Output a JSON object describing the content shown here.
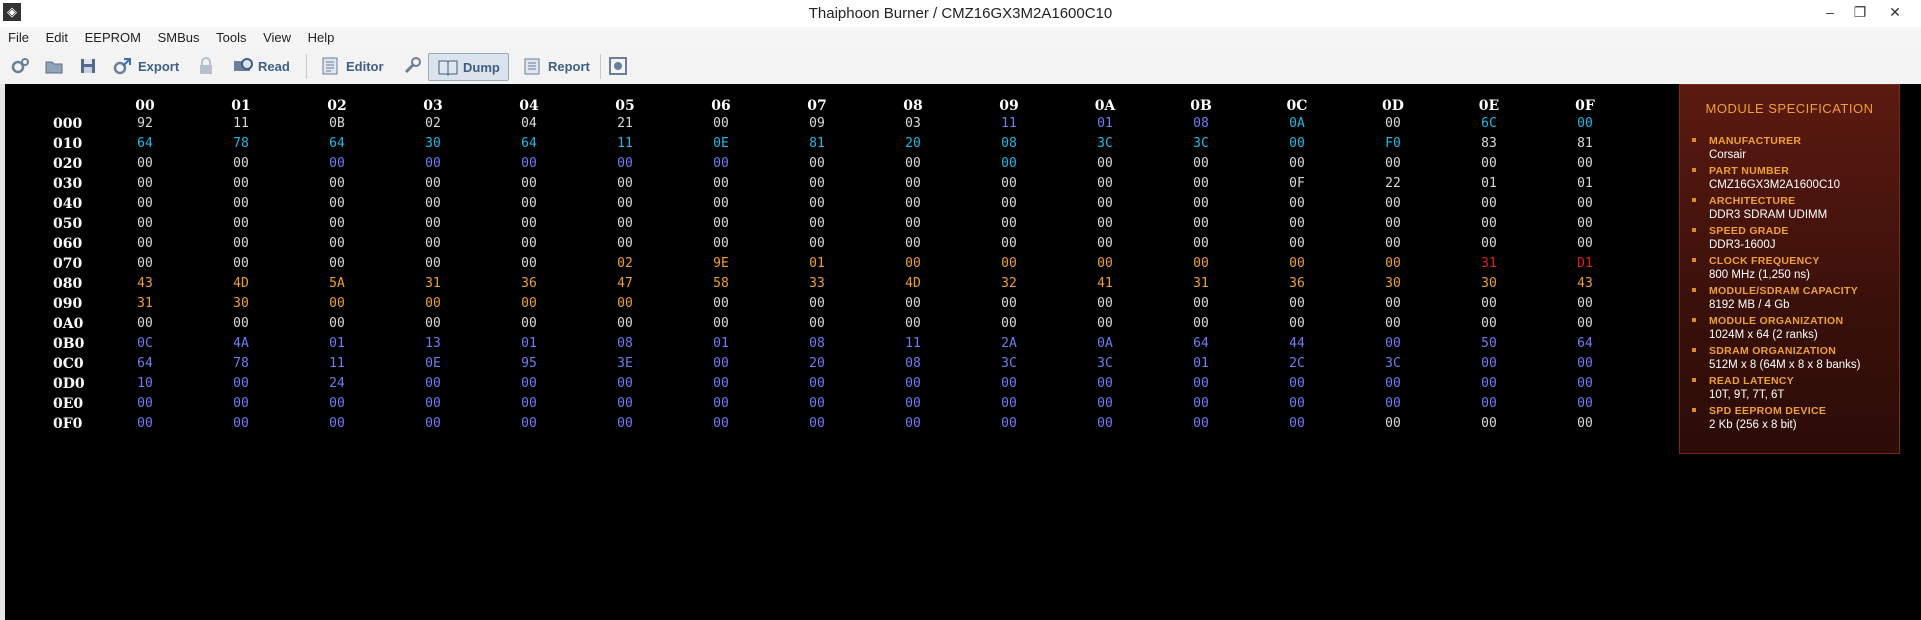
{
  "window": {
    "title": "Thaiphoon Burner / CMZ16GX3M2A1600C10",
    "minimize": "–",
    "restore": "❐",
    "close": "✕"
  },
  "menu": [
    "File",
    "Edit",
    "EEPROM",
    "SMBus",
    "Tools",
    "View",
    "Help"
  ],
  "toolbar": {
    "export": "Export",
    "read": "Read",
    "editor": "Editor",
    "dump": "Dump",
    "report": "Report"
  },
  "colors": {
    "white": "#d9d9d9",
    "cyan": "#21b8e8",
    "blue": "#6f7cf0",
    "orange": "#f0a030",
    "red": "#e02020"
  },
  "dump": {
    "columns": [
      "00",
      "01",
      "02",
      "03",
      "04",
      "05",
      "06",
      "07",
      "08",
      "09",
      "0A",
      "0B",
      "0C",
      "0D",
      "0E",
      "0F"
    ],
    "rows": [
      {
        "addr": "000",
        "values": [
          "92",
          "11",
          "0B",
          "02",
          "04",
          "21",
          "00",
          "09",
          "03",
          "11",
          "01",
          "08",
          "0A",
          "00",
          "6C",
          "00"
        ],
        "colors": [
          "w",
          "w",
          "w",
          "w",
          "w",
          "w",
          "w",
          "w",
          "w",
          "b",
          "b",
          "b",
          "c",
          "w",
          "c",
          "c"
        ]
      },
      {
        "addr": "010",
        "values": [
          "64",
          "78",
          "64",
          "30",
          "64",
          "11",
          "0E",
          "81",
          "20",
          "08",
          "3C",
          "3C",
          "00",
          "F0",
          "83",
          "81"
        ],
        "colors": [
          "c",
          "c",
          "c",
          "c",
          "c",
          "c",
          "c",
          "c",
          "c",
          "c",
          "c",
          "c",
          "c",
          "c",
          "w",
          "w"
        ]
      },
      {
        "addr": "020",
        "values": [
          "00",
          "00",
          "00",
          "00",
          "00",
          "00",
          "00",
          "00",
          "00",
          "00",
          "00",
          "00",
          "00",
          "00",
          "00",
          "00"
        ],
        "colors": [
          "w",
          "w",
          "b",
          "b",
          "b",
          "b",
          "b",
          "w",
          "w",
          "c",
          "w",
          "w",
          "w",
          "w",
          "w",
          "w"
        ]
      },
      {
        "addr": "030",
        "values": [
          "00",
          "00",
          "00",
          "00",
          "00",
          "00",
          "00",
          "00",
          "00",
          "00",
          "00",
          "00",
          "0F",
          "22",
          "01",
          "01"
        ],
        "colors": [
          "w",
          "w",
          "w",
          "w",
          "w",
          "w",
          "w",
          "w",
          "w",
          "w",
          "w",
          "w",
          "w",
          "w",
          "w",
          "w"
        ]
      },
      {
        "addr": "040",
        "values": [
          "00",
          "00",
          "00",
          "00",
          "00",
          "00",
          "00",
          "00",
          "00",
          "00",
          "00",
          "00",
          "00",
          "00",
          "00",
          "00"
        ],
        "colors": [
          "w",
          "w",
          "w",
          "w",
          "w",
          "w",
          "w",
          "w",
          "w",
          "w",
          "w",
          "w",
          "w",
          "w",
          "w",
          "w"
        ]
      },
      {
        "addr": "050",
        "values": [
          "00",
          "00",
          "00",
          "00",
          "00",
          "00",
          "00",
          "00",
          "00",
          "00",
          "00",
          "00",
          "00",
          "00",
          "00",
          "00"
        ],
        "colors": [
          "w",
          "w",
          "w",
          "w",
          "w",
          "w",
          "w",
          "w",
          "w",
          "w",
          "w",
          "w",
          "w",
          "w",
          "w",
          "w"
        ]
      },
      {
        "addr": "060",
        "values": [
          "00",
          "00",
          "00",
          "00",
          "00",
          "00",
          "00",
          "00",
          "00",
          "00",
          "00",
          "00",
          "00",
          "00",
          "00",
          "00"
        ],
        "colors": [
          "w",
          "w",
          "w",
          "w",
          "w",
          "w",
          "w",
          "w",
          "w",
          "w",
          "w",
          "w",
          "w",
          "w",
          "w",
          "w"
        ]
      },
      {
        "addr": "070",
        "values": [
          "00",
          "00",
          "00",
          "00",
          "00",
          "02",
          "9E",
          "01",
          "00",
          "00",
          "00",
          "00",
          "00",
          "00",
          "31",
          "D1"
        ],
        "colors": [
          "w",
          "w",
          "w",
          "w",
          "w",
          "o",
          "o",
          "o",
          "o",
          "o",
          "o",
          "o",
          "o",
          "o",
          "r",
          "r"
        ]
      },
      {
        "addr": "080",
        "values": [
          "43",
          "4D",
          "5A",
          "31",
          "36",
          "47",
          "58",
          "33",
          "4D",
          "32",
          "41",
          "31",
          "36",
          "30",
          "30",
          "43"
        ],
        "colors": [
          "o",
          "o",
          "o",
          "o",
          "o",
          "o",
          "o",
          "o",
          "o",
          "o",
          "o",
          "o",
          "o",
          "o",
          "o",
          "o"
        ]
      },
      {
        "addr": "090",
        "values": [
          "31",
          "30",
          "00",
          "00",
          "00",
          "00",
          "00",
          "00",
          "00",
          "00",
          "00",
          "00",
          "00",
          "00",
          "00",
          "00"
        ],
        "colors": [
          "o",
          "o",
          "o",
          "o",
          "o",
          "o",
          "w",
          "w",
          "w",
          "w",
          "w",
          "w",
          "w",
          "w",
          "w",
          "w"
        ]
      },
      {
        "addr": "0A0",
        "values": [
          "00",
          "00",
          "00",
          "00",
          "00",
          "00",
          "00",
          "00",
          "00",
          "00",
          "00",
          "00",
          "00",
          "00",
          "00",
          "00"
        ],
        "colors": [
          "w",
          "w",
          "w",
          "w",
          "w",
          "w",
          "w",
          "w",
          "w",
          "w",
          "w",
          "w",
          "w",
          "w",
          "w",
          "w"
        ]
      },
      {
        "addr": "0B0",
        "values": [
          "0C",
          "4A",
          "01",
          "13",
          "01",
          "08",
          "01",
          "08",
          "11",
          "2A",
          "0A",
          "64",
          "44",
          "00",
          "50",
          "64"
        ],
        "colors": [
          "b",
          "b",
          "b",
          "b",
          "b",
          "b",
          "b",
          "b",
          "b",
          "b",
          "b",
          "b",
          "b",
          "b",
          "b",
          "b"
        ]
      },
      {
        "addr": "0C0",
        "values": [
          "64",
          "78",
          "11",
          "0E",
          "95",
          "3E",
          "00",
          "20",
          "08",
          "3C",
          "3C",
          "01",
          "2C",
          "3C",
          "00",
          "00"
        ],
        "colors": [
          "b",
          "b",
          "b",
          "b",
          "b",
          "b",
          "b",
          "b",
          "b",
          "b",
          "b",
          "b",
          "b",
          "b",
          "b",
          "b"
        ]
      },
      {
        "addr": "0D0",
        "values": [
          "10",
          "00",
          "24",
          "00",
          "00",
          "00",
          "00",
          "00",
          "00",
          "00",
          "00",
          "00",
          "00",
          "00",
          "00",
          "00"
        ],
        "colors": [
          "b",
          "b",
          "b",
          "b",
          "b",
          "b",
          "b",
          "b",
          "b",
          "b",
          "b",
          "b",
          "b",
          "b",
          "b",
          "b"
        ]
      },
      {
        "addr": "0E0",
        "values": [
          "00",
          "00",
          "00",
          "00",
          "00",
          "00",
          "00",
          "00",
          "00",
          "00",
          "00",
          "00",
          "00",
          "00",
          "00",
          "00"
        ],
        "colors": [
          "b",
          "b",
          "b",
          "b",
          "b",
          "b",
          "b",
          "b",
          "b",
          "b",
          "b",
          "b",
          "b",
          "b",
          "b",
          "b"
        ]
      },
      {
        "addr": "0F0",
        "values": [
          "00",
          "00",
          "00",
          "00",
          "00",
          "00",
          "00",
          "00",
          "00",
          "00",
          "00",
          "00",
          "00",
          "00",
          "00",
          "00"
        ],
        "colors": [
          "b",
          "b",
          "b",
          "b",
          "b",
          "b",
          "b",
          "b",
          "b",
          "b",
          "b",
          "b",
          "b",
          "w",
          "w",
          "w"
        ]
      }
    ]
  },
  "spec": {
    "title": "MODULE SPECIFICATION",
    "items": [
      {
        "label": "MANUFACTURER",
        "value": "Corsair"
      },
      {
        "label": "PART NUMBER",
        "value": "CMZ16GX3M2A1600C10"
      },
      {
        "label": "ARCHITECTURE",
        "value": "DDR3 SDRAM UDIMM"
      },
      {
        "label": "SPEED GRADE",
        "value": "DDR3-1600J"
      },
      {
        "label": "CLOCK FREQUENCY",
        "value": "800 MHz (1,250 ns)"
      },
      {
        "label": "MODULE/SDRAM CAPACITY",
        "value": "8192 MB / 4 Gb"
      },
      {
        "label": "MODULE ORGANIZATION",
        "value": "1024M x 64 (2 ranks)"
      },
      {
        "label": "SDRAM ORGANIZATION",
        "value": "512M x 8 (64M x 8 x 8 banks)"
      },
      {
        "label": "READ LATENCY",
        "value": "10T, 9T, 7T, 6T"
      },
      {
        "label": "SPD EEPROM DEVICE",
        "value": "2 Kb (256 x 8 bit)"
      }
    ]
  }
}
